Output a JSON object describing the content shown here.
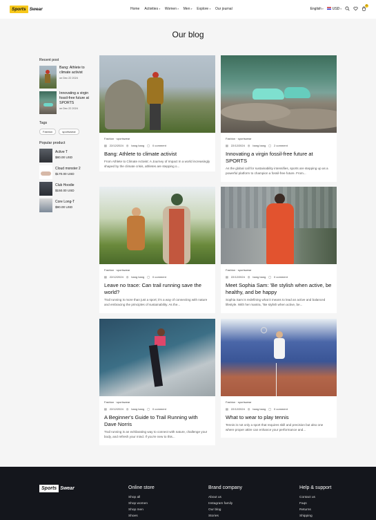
{
  "brand": {
    "sports": "Sports",
    "swear": "Swear"
  },
  "nav": [
    {
      "label": "Home",
      "caret": false
    },
    {
      "label": "Activities",
      "caret": true
    },
    {
      "label": "Women",
      "caret": true
    },
    {
      "label": "Men",
      "caret": true
    },
    {
      "label": "Explore",
      "caret": true
    },
    {
      "label": "Our journal",
      "caret": false
    }
  ],
  "header_right": {
    "language": "English",
    "currency": "USD",
    "cart_count": "0"
  },
  "page_title": "Our blog",
  "sidebar": {
    "recent_title": "Recent post",
    "recent": [
      {
        "title": "Bang: Athlete to climate activist",
        "date": "Dec 22 2024",
        "on": "on"
      },
      {
        "title": "Innovating a virgin fossil-free future at SPORTS",
        "date": "Dec 22 2024",
        "on": "on"
      }
    ],
    "tags_title": "Tags",
    "tags": [
      "Fashion",
      "sportswear"
    ],
    "popular_title": "Popular product",
    "products": [
      {
        "name": "Active T",
        "price": "$80.00 USD"
      },
      {
        "name": "Cloud monster 2",
        "price": "$170.00 USD"
      },
      {
        "name": "Club Hoodie",
        "price": "$150.00 USD"
      },
      {
        "name": "Core Long-T",
        "price": "$90.00 USD"
      }
    ]
  },
  "posts": [
    {
      "cat1": "Fashion",
      "cat2": "sportswear",
      "date": "22/12/2024",
      "author": "bang bang",
      "comments": "0 comment",
      "title": "Bang: Athlete to climate activist",
      "excerpt": "From Athlete to Climate Activist: A Journey of Impact In a world increasingly shaped by the climate crisis, athletes are stepping o..."
    },
    {
      "cat1": "Fashion",
      "cat2": "sportswear",
      "date": "22/12/2024",
      "author": "bang bang",
      "comments": "2 comment",
      "title": "Innovating a virgin fossil-free future at SPORTS",
      "excerpt": "As the global call for sustainability intensifies, sports are stepping up as a powerful platform to champion a fossil-free future. From..."
    },
    {
      "cat1": "Fashion",
      "cat2": "sportswear",
      "date": "22/12/2024",
      "author": "bang bang",
      "comments": "0 comment",
      "title": "Leave no trace: Can trail running save the world?",
      "excerpt": "Trail running is more than just a sport; it's a way of connecting with nature and embracing the principles of sustainability. As the..."
    },
    {
      "cat1": "Fashion",
      "cat2": "sportswear",
      "date": "22/12/2024",
      "author": "bang bang",
      "comments": "0 comment",
      "title": "Meet Sophia Sam: 'Be stylish when active, be healthy, and be happy",
      "excerpt": "Sophia Sam is redefining what it means to lead an active and balanced lifestyle. With her mantra, \"Be stylish when active, be..."
    },
    {
      "cat1": "Fashion",
      "cat2": "sportswear",
      "date": "22/12/2024",
      "author": "bang bang",
      "comments": "0 comment",
      "title": "A Beginner's Guide to Trail Running with Dave Norris",
      "excerpt": "Trail running is an exhilarating way to connect with nature, challenge your body, and refresh your mind. If you're new to this..."
    },
    {
      "cat1": "Fashion",
      "cat2": "sportswear",
      "date": "22/12/2024",
      "author": "bang bang",
      "comments": "0 comment",
      "title": "What to wear to play tennis",
      "excerpt": "Tennis is not only a sport that requires skill and precision but also one where proper attire can enhance your performance and..."
    }
  ],
  "footer": {
    "cols": [
      {
        "title": "Online store",
        "links": [
          "Shop all",
          "Shop women",
          "Shop men",
          "Shoes"
        ]
      },
      {
        "title": "Brand company",
        "links": [
          "About us",
          "Instagram family",
          "Our blog",
          "Stories"
        ]
      },
      {
        "title": "Help & support",
        "links": [
          "Contact us",
          "Faqs",
          "Returns",
          "Shipping"
        ]
      }
    ]
  }
}
